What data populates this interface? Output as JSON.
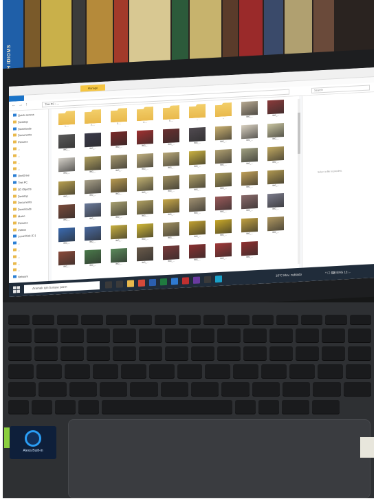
{
  "scene": {
    "description_kind": "photo of laptop showing file explorer",
    "colors": {
      "screen_bg": "#f7f8fa",
      "taskbar": "#202c3a",
      "keyboard": "#1a1b1d",
      "folder_yellow": "#e9b94c"
    }
  },
  "bookshelf": {
    "spines": [
      {
        "text": "WITH IDIOMS",
        "color": "#1f5fa8"
      },
      {
        "text": "",
        "color": "#7a5a2a"
      },
      {
        "text": "",
        "color": "#c9b04a"
      },
      {
        "text": "",
        "color": "#3b3b3b"
      },
      {
        "text": "",
        "color": "#b58a3a"
      },
      {
        "text": "",
        "color": "#a23a2a"
      },
      {
        "text": "",
        "color": "#d8c892"
      },
      {
        "text": "",
        "color": "#2c5a3a"
      },
      {
        "text": "",
        "color": "#c7b36d"
      },
      {
        "text": "",
        "color": "#5a3b2a"
      },
      {
        "text": "",
        "color": "#9a2a2a"
      },
      {
        "text": "",
        "color": "#3a4a6a"
      },
      {
        "text": "",
        "color": "#b0a070"
      },
      {
        "text": "",
        "color": "#6a4a3a"
      }
    ]
  },
  "explorer": {
    "ribbon_tab": "Manage",
    "address": "This PC › ...",
    "search_placeholder": "Search",
    "preview_message": "Select a file to preview.",
    "nav_items": [
      {
        "label": "Quick access",
        "icon": "star-icon"
      },
      {
        "label": "Desktop",
        "icon": "folder-icon"
      },
      {
        "label": "Downloads",
        "icon": "download-icon"
      },
      {
        "label": "Documents",
        "icon": "folder-icon"
      },
      {
        "label": "Pictures",
        "icon": "folder-icon"
      },
      {
        "label": "...",
        "icon": "folder-icon"
      },
      {
        "label": "...",
        "icon": "folder-icon"
      },
      {
        "label": "...",
        "icon": "folder-icon"
      },
      {
        "label": "...",
        "icon": "folder-icon"
      },
      {
        "label": "OneDrive",
        "icon": "cloud-icon"
      },
      {
        "label": "This PC",
        "icon": "pc-icon"
      },
      {
        "label": "3D Objects",
        "icon": "folder-icon"
      },
      {
        "label": "Desktop",
        "icon": "folder-icon"
      },
      {
        "label": "Documents",
        "icon": "folder-icon"
      },
      {
        "label": "Downloads",
        "icon": "folder-icon"
      },
      {
        "label": "Music",
        "icon": "folder-icon"
      },
      {
        "label": "Pictures",
        "icon": "folder-icon"
      },
      {
        "label": "Videos",
        "icon": "folder-icon"
      },
      {
        "label": "Local Disk (C:)",
        "icon": "drive-icon"
      },
      {
        "label": "...",
        "icon": "drive-icon"
      },
      {
        "label": "...",
        "icon": "folder-icon"
      },
      {
        "label": "...",
        "icon": "folder-icon"
      },
      {
        "label": "...",
        "icon": "folder-icon"
      },
      {
        "label": "...",
        "icon": "folder-icon"
      },
      {
        "label": "Network",
        "icon": "network-icon"
      }
    ],
    "folders": [
      {
        "label": "1. ...",
        "color": "#e9b94c"
      },
      {
        "label": "2. ...",
        "color": "#e9b94c"
      },
      {
        "label": "3. ...",
        "color": "#e9b94c"
      },
      {
        "label": "4. ...",
        "color": "#e9b94c"
      },
      {
        "label": "5. ...",
        "color": "#e9b94c"
      },
      {
        "label": "...",
        "color": "#e9b94c"
      },
      {
        "label": "...",
        "color": "#e9b94c"
      }
    ],
    "image_files": [
      {
        "label": "IMG_...",
        "color": "#b6a890"
      },
      {
        "label": "IMG_...",
        "color": "#8a3a3a"
      },
      {
        "label": "IMG_...",
        "color": "#5a5a5a"
      },
      {
        "label": "IMG_...",
        "color": "#3a3a4a"
      },
      {
        "label": "IMG_...",
        "color": "#7a2a2a"
      },
      {
        "label": "IMG_...",
        "color": "#a03030"
      },
      {
        "label": "IMG_...",
        "color": "#6a3030"
      },
      {
        "label": "IMG_...",
        "color": "#504a50"
      },
      {
        "label": "IMG_...",
        "color": "#c9b070"
      },
      {
        "label": "IMG_...",
        "color": "#d8d0c0"
      },
      {
        "label": "IMG_...",
        "color": "#c8c4a0"
      },
      {
        "label": "IMG_...",
        "color": "#d4d0c8"
      },
      {
        "label": "IMG_...",
        "color": "#b0a060"
      },
      {
        "label": "IMG_...",
        "color": "#a89a70"
      },
      {
        "label": "IMG_...",
        "color": "#c0b080"
      },
      {
        "label": "IMG_...",
        "color": "#b8a878"
      },
      {
        "label": "IMG_...",
        "color": "#c8b040"
      },
      {
        "label": "IMG_...",
        "color": "#b0a070"
      },
      {
        "label": "IMG_...",
        "color": "#a0a080"
      },
      {
        "label": "IMG_...",
        "color": "#c0a860"
      },
      {
        "label": "IMG_...",
        "color": "#b8a050"
      },
      {
        "label": "IMG_...",
        "color": "#a8a088"
      },
      {
        "label": "IMG_...",
        "color": "#b89a50"
      },
      {
        "label": "IMG_...",
        "color": "#c0b070"
      },
      {
        "label": "IMG_...",
        "color": "#a09060"
      },
      {
        "label": "IMG_...",
        "color": "#b0a068"
      },
      {
        "label": "IMG_...",
        "color": "#a8985a"
      },
      {
        "label": "IMG_...",
        "color": "#c0a058"
      },
      {
        "label": "IMG_...",
        "color": "#b09850"
      },
      {
        "label": "IMG_...",
        "color": "#7a4a3a"
      },
      {
        "label": "IMG_...",
        "color": "#6a7a9a"
      },
      {
        "label": "IMG_...",
        "color": "#a8a070"
      },
      {
        "label": "IMG_...",
        "color": "#b0a060"
      },
      {
        "label": "IMG_...",
        "color": "#c8a848"
      },
      {
        "label": "IMG_...",
        "color": "#a09070"
      },
      {
        "label": "IMG_...",
        "color": "#9a5a5a"
      },
      {
        "label": "IMG_...",
        "color": "#8a6a6a"
      },
      {
        "label": "IMG_...",
        "color": "#7a7a8a"
      },
      {
        "label": "IMG_...",
        "color": "#3a6ab0"
      },
      {
        "label": "IMG_...",
        "color": "#4a6aa0"
      },
      {
        "label": "IMG_...",
        "color": "#c8b040"
      },
      {
        "label": "IMG_...",
        "color": "#d0b838"
      },
      {
        "label": "IMG_...",
        "color": "#a09060"
      },
      {
        "label": "IMG_...",
        "color": "#c0a030"
      },
      {
        "label": "IMG_...",
        "color": "#c8a828"
      },
      {
        "label": "IMG_...",
        "color": "#c0a040"
      },
      {
        "label": "IMG_...",
        "color": "#b09860"
      },
      {
        "label": "IMG_...",
        "color": "#8a4a3a"
      },
      {
        "label": "IMG_...",
        "color": "#4a7a4a"
      },
      {
        "label": "IMG_...",
        "color": "#5a8a5a"
      },
      {
        "label": "IMG_...",
        "color": "#6a5a4a"
      },
      {
        "label": "IMG_...",
        "color": "#7a3a3a"
      },
      {
        "label": "IMG_...",
        "color": "#8a3030"
      },
      {
        "label": "IMG_...",
        "color": "#a03838"
      },
      {
        "label": "IMG_...",
        "color": "#903030"
      }
    ]
  },
  "taskbar": {
    "search_placeholder": "Aramak için buraya yazın",
    "weather": "10°C  Mov. nublado",
    "tray": "^ ☐ ⌨ ENG  12:...",
    "apps": [
      {
        "icon": "cortana-icon",
        "color": "#3a3a3a"
      },
      {
        "icon": "task-view-icon",
        "color": "#3a3a3a"
      },
      {
        "icon": "explorer-icon",
        "color": "#e9b94c"
      },
      {
        "icon": "chrome-icon",
        "color": "#d44a3a"
      },
      {
        "icon": "word-icon",
        "color": "#2b5fb0"
      },
      {
        "icon": "excel-icon",
        "color": "#1f7a3f"
      },
      {
        "icon": "mail-icon",
        "color": "#2f7ad0"
      },
      {
        "icon": "app-icon",
        "color": "#c03030"
      },
      {
        "icon": "app-icon",
        "color": "#6a3aa0"
      },
      {
        "icon": "settings-icon",
        "color": "#3a3a3a"
      },
      {
        "icon": "edge-icon",
        "color": "#1aa0c8"
      }
    ]
  },
  "sticker": {
    "label": "Alexa Built-in"
  }
}
